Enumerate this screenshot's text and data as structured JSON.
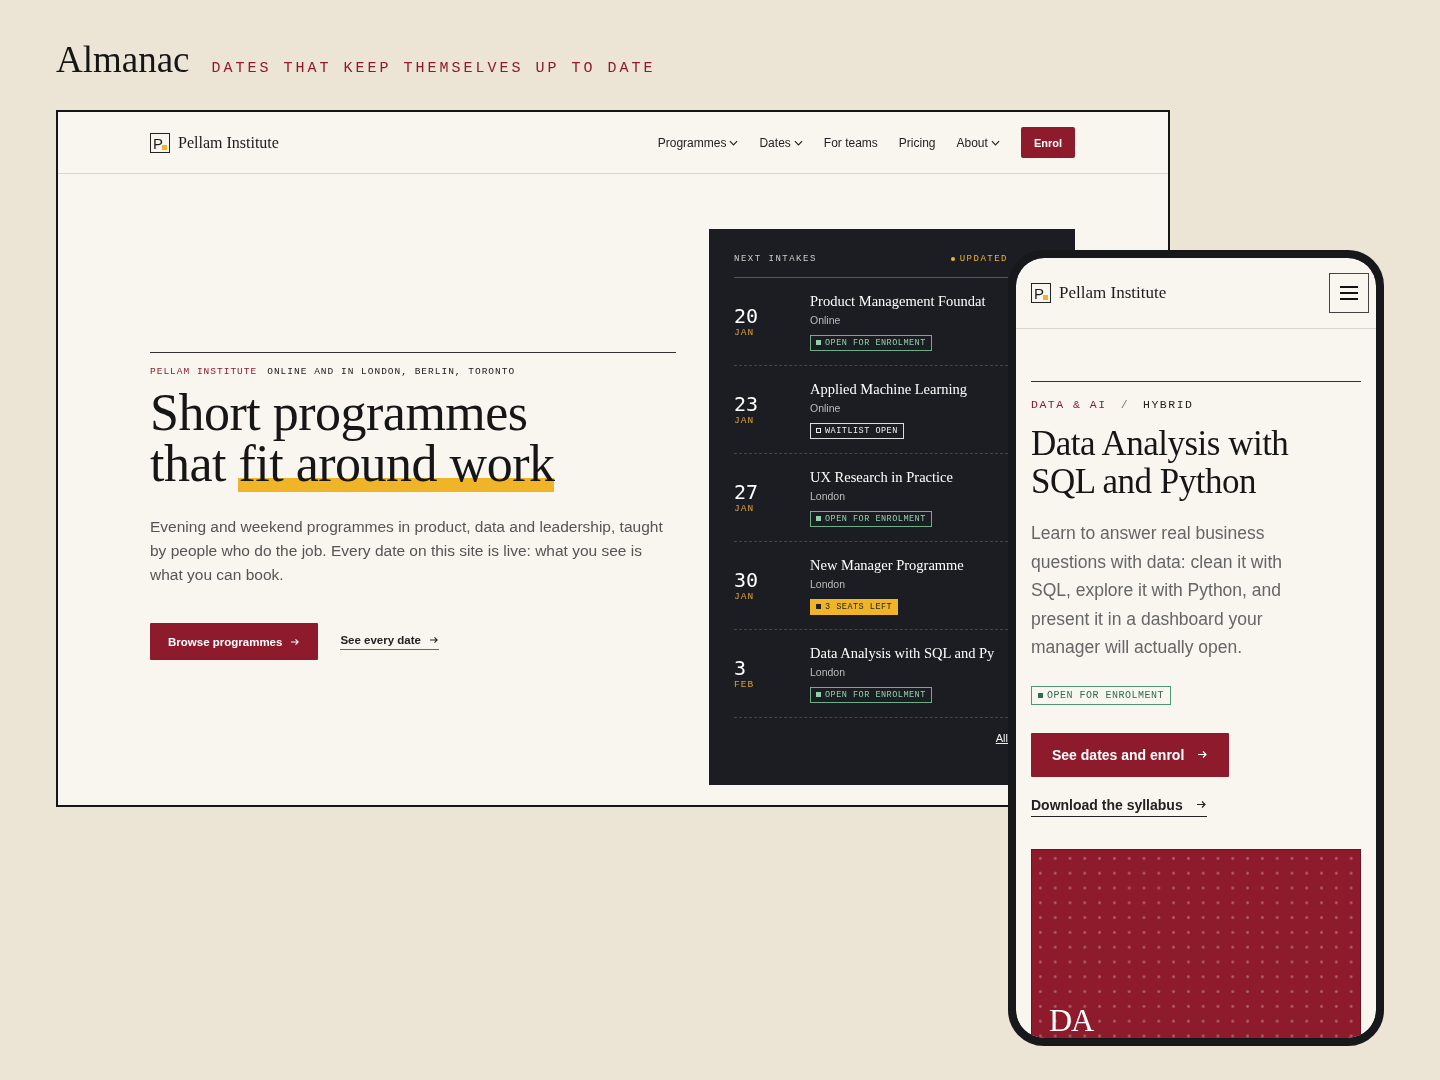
{
  "brand": {
    "name": "Almanac",
    "tagline": "DATES THAT KEEP THEMSELVES UP TO DATE"
  },
  "desktop": {
    "logo": {
      "mark": "P",
      "name": "Pellam Institute"
    },
    "nav": [
      {
        "label": "Programmes",
        "dropdown": true
      },
      {
        "label": "Dates",
        "dropdown": true
      },
      {
        "label": "For teams",
        "dropdown": false
      },
      {
        "label": "Pricing",
        "dropdown": false
      },
      {
        "label": "About",
        "dropdown": true
      }
    ],
    "cta": "Enrol",
    "hero": {
      "eyebrow": "PELLAM INSTITUTE",
      "eyebrow_detail": "ONLINE AND IN LONDON, BERLIN, TORONTO",
      "title_line_1": "Short programmes",
      "title_plain": "that",
      "title_highlight": "fit around work",
      "body": "Evening and weekend programmes in product, data and leadership, taught by people who do the job. Every date on this site is live: what you see is what you can book.",
      "primary_button": "Browse programmes",
      "secondary_link": "See every date"
    },
    "intakes": {
      "title": "NEXT INTAKES",
      "status": "UPDATED",
      "items": [
        {
          "day": "20",
          "month": "JAN",
          "title": "Product Management Foundat",
          "location": "Online",
          "badge": {
            "kind": "open",
            "label": "OPEN FOR ENROLMENT"
          }
        },
        {
          "day": "23",
          "month": "JAN",
          "title": "Applied Machine Learning",
          "location": "Online",
          "badge": {
            "kind": "waitlist",
            "label": "WAITLIST OPEN"
          }
        },
        {
          "day": "27",
          "month": "JAN",
          "title": "UX Research in Practice",
          "location": "London",
          "badge": {
            "kind": "open",
            "label": "OPEN FOR ENROLMENT"
          }
        },
        {
          "day": "30",
          "month": "JAN",
          "title": "New Manager Programme",
          "location": "London",
          "badge": {
            "kind": "seats",
            "label": "3 SEATS LEFT"
          }
        },
        {
          "day": "3",
          "month": "FEB",
          "title": "Data Analysis with SQL and Py",
          "location": "London",
          "badge": {
            "kind": "open",
            "label": "OPEN FOR ENROLMENT"
          }
        }
      ],
      "more_link": "All"
    }
  },
  "mobile": {
    "logo": {
      "mark": "P",
      "name": "Pellam Institute"
    },
    "category": "DATA & AI",
    "separator": "/",
    "format": "HYBRID",
    "title": "Data Analysis with SQL and Python",
    "body": "Learn to answer real business questions with data: clean it with SQL, explore it with Python, and present it in a dashboard your manager will actually open.",
    "badge": {
      "kind": "open",
      "label": "OPEN FOR ENROLMENT"
    },
    "primary_button": "See dates and enrol",
    "secondary_link": "Download the syllabus",
    "cover_initials": "DA"
  }
}
